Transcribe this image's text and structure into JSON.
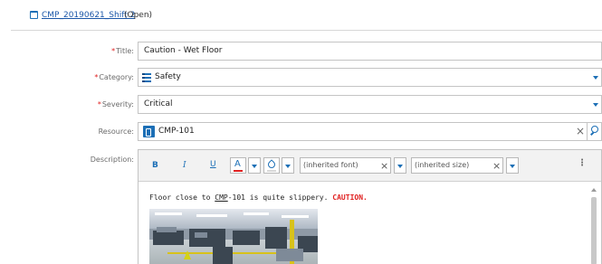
{
  "header": {
    "icon": "calendar-icon",
    "record_link": "CMP_20190621_Shift 2",
    "status": " (Open)"
  },
  "form": {
    "title": {
      "label": "Title:",
      "required": true,
      "value": "Caution - Wet Floor"
    },
    "category": {
      "label": "Category:",
      "required": true,
      "value": "Safety",
      "icon": "list-icon"
    },
    "severity": {
      "label": "Severity:",
      "required": true,
      "value": "Critical"
    },
    "resource": {
      "label": "Resource:",
      "required": false,
      "value": "CMP-101",
      "icon": "resource-icon"
    },
    "description": {
      "label": "Description:",
      "required": false
    }
  },
  "editor": {
    "toolbar": {
      "bold": "B",
      "italic": "I",
      "underline": "U",
      "font_color_glyph": "A",
      "font_family": "(inherited font)",
      "font_size": "(inherited size)",
      "more": "⋮"
    },
    "content": {
      "text_before": "Floor close to ",
      "reference": "CMP",
      "text_middle": "-101 is quite slippery. ",
      "caution": "CAUTION."
    }
  },
  "colors": {
    "accent": "#1c6fb6",
    "required": "#e02020",
    "caution": "#e02020",
    "link": "#1a56a8"
  }
}
